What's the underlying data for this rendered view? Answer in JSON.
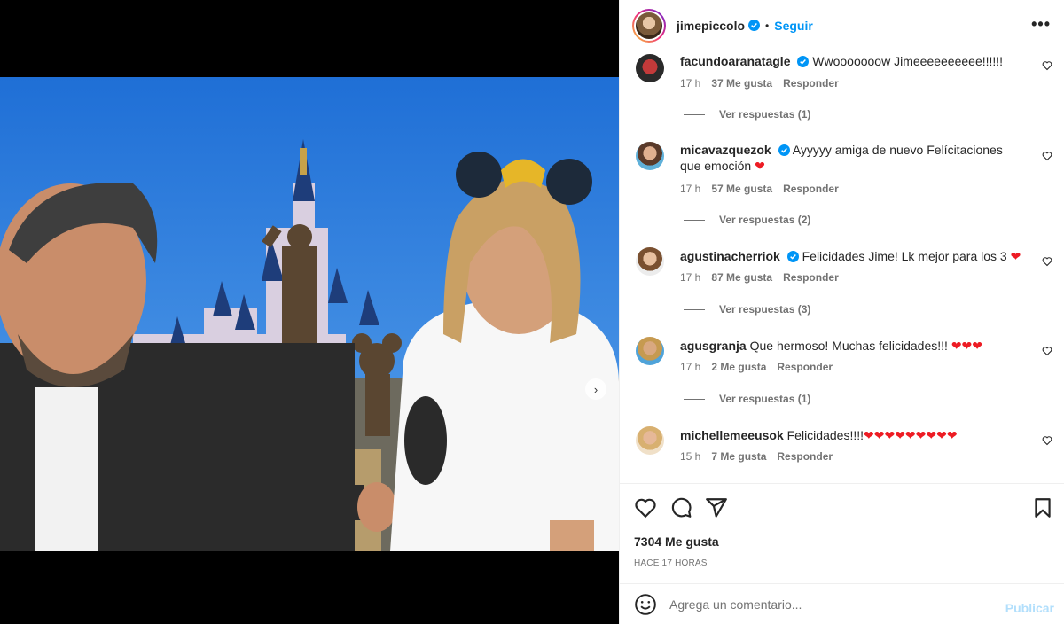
{
  "post": {
    "author": "jimepiccolo",
    "follow_label": "Seguir",
    "separator": "•",
    "more_label": "•••"
  },
  "media": {
    "slide_count": 2,
    "active_slide": 1
  },
  "comments": [
    {
      "user": "facundoaranatagle",
      "verified": true,
      "text": "Wwooooooow Jimeeeeeeeeee!!!!!!",
      "time": "17 h",
      "likes": "37 Me gusta",
      "reply": "Responder",
      "view_replies": "Ver respuestas (1)"
    },
    {
      "user": "micavazquezok",
      "verified": true,
      "text": "Ayyyyy amiga de nuevo Felícitaciones que emoción",
      "hearts": "❤",
      "time": "17 h",
      "likes": "57 Me gusta",
      "reply": "Responder",
      "view_replies": "Ver respuestas (2)"
    },
    {
      "user": "agustinacherriok",
      "verified": true,
      "text": "Felicidades Jime! Lk mejor para los 3",
      "hearts": "❤",
      "time": "17 h",
      "likes": "87 Me gusta",
      "reply": "Responder",
      "view_replies": "Ver respuestas (3)"
    },
    {
      "user": "agusgranja",
      "verified": false,
      "text": "Que hermoso! Muchas felicidades!!!",
      "hearts": "❤❤❤",
      "time": "17 h",
      "likes": "2 Me gusta",
      "reply": "Responder",
      "view_replies": "Ver respuestas (1)"
    },
    {
      "user": "michellemeeusok",
      "verified": false,
      "text": "Felicidades!!!!",
      "hearts": "❤❤❤❤❤❤❤❤❤",
      "time": "15 h",
      "likes": "7 Me gusta",
      "reply": "Responder"
    }
  ],
  "stats": {
    "likes": "7304 Me gusta",
    "posted": "HACE 17 HORAS"
  },
  "composer": {
    "placeholder": "Agrega un comentario...",
    "publish_label": "Publicar"
  },
  "colors": {
    "accent": "#0095f6",
    "publish_disabled": "#b2dffc",
    "heart": "#ed1c24",
    "muted_text": "#737373"
  },
  "icons": [
    "verified-badge-icon",
    "more-options-icon",
    "heart-outline-icon",
    "comment-icon",
    "share-icon",
    "save-icon",
    "emoji-icon",
    "chevron-right-icon"
  ]
}
